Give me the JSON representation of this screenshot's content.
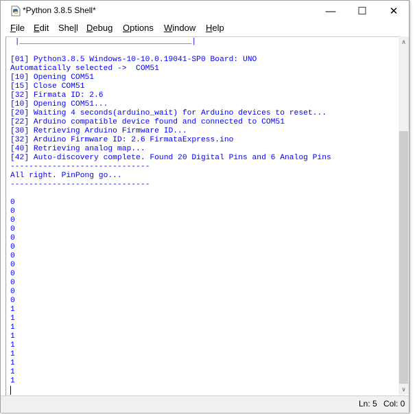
{
  "window": {
    "title": "*Python 3.8.5 Shell*",
    "controls": {
      "minimize": "—",
      "maximize": "☐",
      "close": "✕"
    }
  },
  "menubar": {
    "items": [
      {
        "key": "F",
        "rest": "ile"
      },
      {
        "key": "E",
        "rest": "dit"
      },
      {
        "pre": "She",
        "key": "l",
        "rest": "l"
      },
      {
        "key": "D",
        "rest": "ebug"
      },
      {
        "key": "O",
        "rest": "ptions"
      },
      {
        "key": "W",
        "rest": "indow"
      },
      {
        "key": "H",
        "rest": "elp"
      }
    ]
  },
  "shell": {
    "lines": [
      " |_____________________________________|",
      "",
      "[01] Python3.8.5 Windows-10-10.0.19041-SP0 Board: UNO",
      "Automatically selected ->  COM51",
      "[10] Opening COM51",
      "[15] Close COM51",
      "[32] Firmata ID: 2.6",
      "[10] Opening COM51...",
      "[20] Waiting 4 seconds(arduino_wait) for Arduino devices to reset...",
      "[22] Arduino compatible device found and connected to COM51",
      "[30] Retrieving Arduino Firmware ID...",
      "[32] Arduino Firmware ID: 2.6 FirmataExpress.ino",
      "[40] Retrieving analog map...",
      "[42] Auto-discovery complete. Found 20 Digital Pins and 6 Analog Pins",
      "------------------------------",
      "All right. PinPong go...",
      "------------------------------",
      "",
      "0",
      "0",
      "0",
      "0",
      "0",
      "0",
      "0",
      "0",
      "0",
      "0",
      "0",
      "0",
      "1",
      "1",
      "1",
      "1",
      "1",
      "1",
      "1",
      "1",
      "1"
    ],
    "text_color": "#0000ff"
  },
  "statusbar": {
    "line": "Ln: 5",
    "col": "Col: 0"
  }
}
